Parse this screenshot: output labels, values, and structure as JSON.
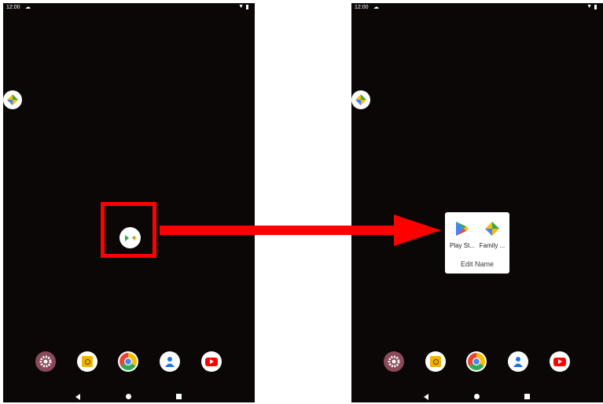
{
  "left_screen": {
    "status": {
      "time": "12:00",
      "cloud_icon": "cloud-icon",
      "wifi_icon": "wifi-icon",
      "battery_icon": "battery-icon"
    },
    "edge_app_icon": "family-link-icon",
    "folder_icon": "app-folder-icon",
    "dock": [
      "settings-icon",
      "files-icon",
      "chrome-icon",
      "contacts-icon",
      "youtube-icon"
    ],
    "nav": [
      "back-icon",
      "home-icon",
      "recents-icon"
    ]
  },
  "right_screen": {
    "status": {
      "time": "12:00"
    },
    "folder_popup": {
      "apps": [
        {
          "label": "Play St...",
          "icon": "play-store-icon"
        },
        {
          "label": "Family ...",
          "icon": "family-link-icon"
        }
      ],
      "edit_name": "Edit Name"
    }
  },
  "annotation": {
    "highlight_color": "#ff0000",
    "arrow_color": "#ff0000"
  },
  "colors": {
    "screen_bg": "#0b0707",
    "settings": "#8a4a5a",
    "files": "#f2b400",
    "youtube": "#ff0000",
    "contacts": "#1a73e8"
  }
}
